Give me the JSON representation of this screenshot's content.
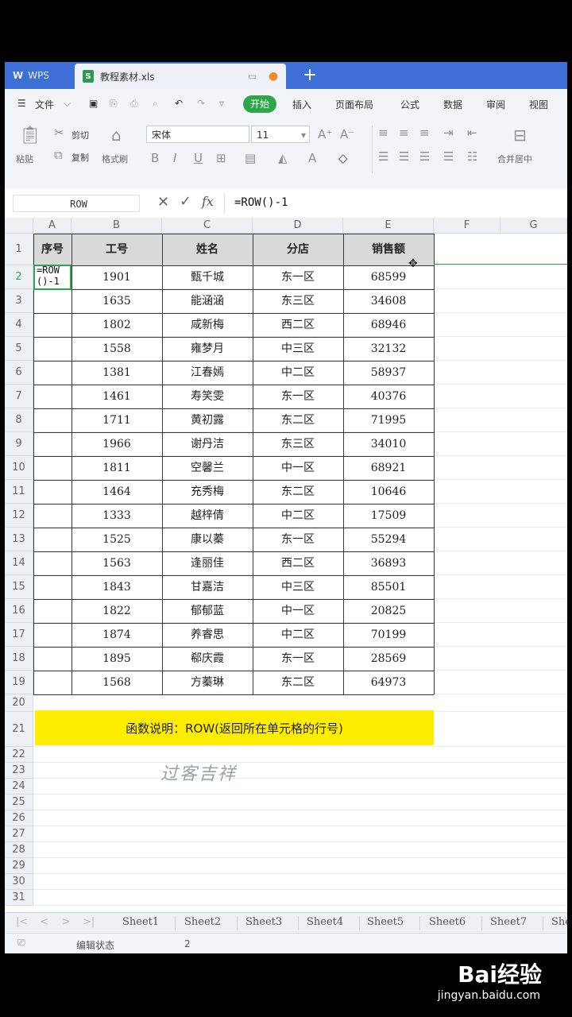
{
  "titlebar": {
    "app": "WPS",
    "file_name": "教程素材.xls",
    "new_tab": "+"
  },
  "menu": {
    "file": "文件",
    "start": "开始",
    "items": [
      "插入",
      "页面布局",
      "公式",
      "数据",
      "审阅",
      "视图"
    ]
  },
  "ribbon": {
    "paste": "粘贴",
    "cut": "剪切",
    "copy": "复制",
    "format_painter": "格式刷",
    "font_name": "宋体",
    "font_size": "11",
    "bold": "B",
    "italic": "I",
    "underline": "U",
    "merge_center": "合并居中"
  },
  "formula_bar": {
    "name_box": "ROW",
    "formula": "=ROW()-1",
    "fx": "fx"
  },
  "columns": [
    "A",
    "B",
    "C",
    "D",
    "E",
    "F",
    "G"
  ],
  "rows": [
    "1",
    "2",
    "3",
    "4",
    "5",
    "6",
    "7",
    "8",
    "9",
    "10",
    "11",
    "12",
    "13",
    "14",
    "15",
    "16",
    "17",
    "18",
    "19",
    "20",
    "21",
    "22",
    "23",
    "24",
    "25",
    "26",
    "27",
    "28",
    "29",
    "30",
    "31"
  ],
  "table": {
    "headers": [
      "序号",
      "工号",
      "姓名",
      "分店",
      "销售额"
    ],
    "editing_cell": {
      "line1": "=ROW",
      "line2": "()-1"
    },
    "records": [
      [
        "1901",
        "甄千城",
        "东一区",
        "68599"
      ],
      [
        "1635",
        "能涵涵",
        "东三区",
        "34608"
      ],
      [
        "1802",
        "咸新梅",
        "西二区",
        "68946"
      ],
      [
        "1558",
        "雍梦月",
        "中三区",
        "32132"
      ],
      [
        "1381",
        "江春嫣",
        "中二区",
        "58937"
      ],
      [
        "1461",
        "寿笑雯",
        "东一区",
        "40376"
      ],
      [
        "1711",
        "黄初露",
        "东二区",
        "71995"
      ],
      [
        "1966",
        "谢丹洁",
        "东三区",
        "34010"
      ],
      [
        "1811",
        "空馨兰",
        "中一区",
        "68921"
      ],
      [
        "1464",
        "充秀梅",
        "东二区",
        "10646"
      ],
      [
        "1333",
        "越梓倩",
        "中二区",
        "17509"
      ],
      [
        "1525",
        "康以蓁",
        "东一区",
        "55294"
      ],
      [
        "1563",
        "逢丽佳",
        "西二区",
        "36893"
      ],
      [
        "1843",
        "甘嘉洁",
        "中三区",
        "85501"
      ],
      [
        "1822",
        "郁郁蓝",
        "中一区",
        "20825"
      ],
      [
        "1874",
        "养睿思",
        "中二区",
        "70199"
      ],
      [
        "1895",
        "郗庆霞",
        "东一区",
        "28569"
      ],
      [
        "1568",
        "方蓁琳",
        "东二区",
        "64973"
      ]
    ]
  },
  "note": "函数说明：ROW(返回所在单元格的行号)",
  "signature": "过客吉祥",
  "sheets": [
    "Sheet1",
    "Sheet2",
    "Sheet3",
    "Sheet4",
    "Sheet5",
    "Sheet6",
    "Sheet7",
    "She"
  ],
  "status": {
    "mode": "编辑状态",
    "count": "2"
  },
  "watermark": {
    "brand": "Bai经验",
    "url": "jingyan.baidu.com"
  },
  "colors": {
    "title_bar": "#3d6fd6",
    "start_button": "#2ea64a",
    "note_bg": "#ffed00",
    "header_fill": "#d9d9d9"
  }
}
